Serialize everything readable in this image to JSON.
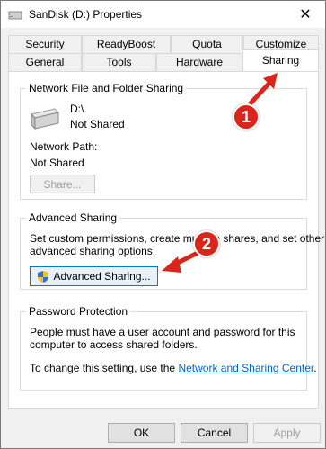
{
  "window": {
    "title": "SanDisk (D:) Properties",
    "close_glyph": "✕"
  },
  "tabs": {
    "row1": [
      "Security",
      "ReadyBoost",
      "Quota",
      "Customize"
    ],
    "row2": [
      "General",
      "Tools",
      "Hardware",
      "Sharing"
    ],
    "active": "Sharing"
  },
  "network_sharing": {
    "group_title": "Network File and Folder Sharing",
    "drive_label": "D:\\",
    "status": "Not Shared",
    "path_label": "Network Path:",
    "path_value": "Not Shared",
    "share_button": "Share..."
  },
  "advanced_sharing": {
    "group_title": "Advanced Sharing",
    "description_line1": "Set custom permissions, create multiple shares, and set other",
    "description_line2": "advanced sharing options.",
    "button": "Advanced Sharing..."
  },
  "password_protection": {
    "group_title": "Password Protection",
    "line1": "People must have a user account and password for this",
    "line2": "computer to access shared folders.",
    "change_prefix": "To change this setting, use the ",
    "link_text": "Network and Sharing Center",
    "change_suffix": "."
  },
  "footer": {
    "ok": "OK",
    "cancel": "Cancel",
    "apply": "Apply"
  },
  "annotations": {
    "badge1": "1",
    "badge2": "2",
    "color": "#d9261c"
  }
}
